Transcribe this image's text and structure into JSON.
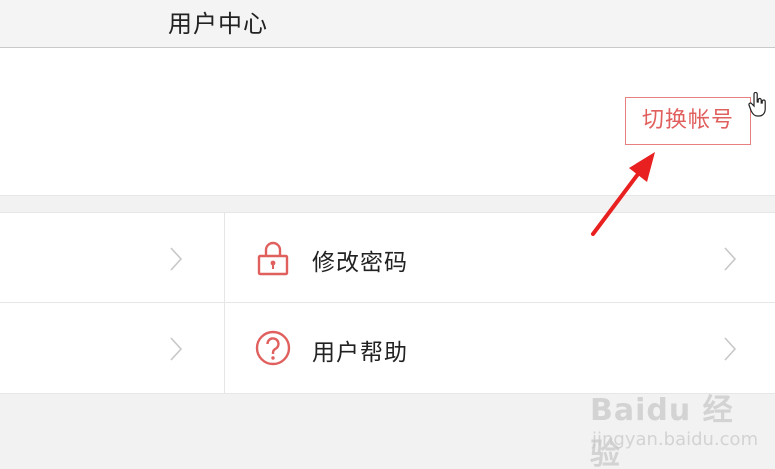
{
  "header": {
    "title": "用户中心"
  },
  "account": {
    "switch_label": "切换帐号"
  },
  "menu": {
    "items": [
      {
        "label": "",
        "icon": "none"
      },
      {
        "label": "修改密码",
        "icon": "lock-icon"
      },
      {
        "label": "",
        "icon": "none"
      },
      {
        "label": "用户帮助",
        "icon": "help-icon"
      }
    ]
  },
  "colors": {
    "accent": "#e0605e",
    "arrow": "#e8201f",
    "background": "#f2f2f2"
  },
  "watermark": {
    "logo": "Baidu 经验",
    "sub": "jingyan.baidu.com"
  }
}
